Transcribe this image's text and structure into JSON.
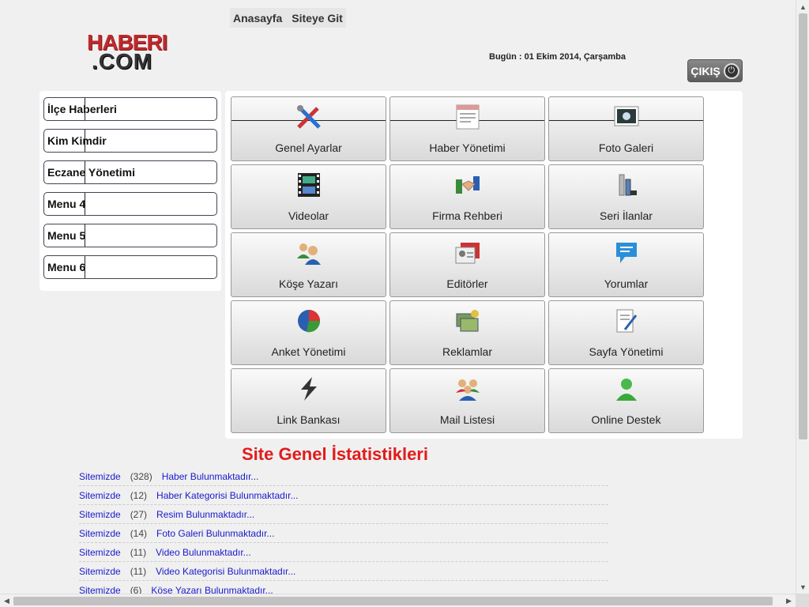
{
  "topnav": {
    "home": "Anasayfa",
    "site": "Siteye Git"
  },
  "logo": {
    "line1": "HABERI",
    "line2": ".COM"
  },
  "date": "Bugün : 01 Ekim 2014, Çarşamba",
  "logout": "ÇIKIŞ",
  "leftmenu": [
    "İlçe Haberleri",
    "Kim Kimdir",
    "Eczane Yönetimi",
    "Menu 4",
    "Menu 5",
    "Menu 6"
  ],
  "tiles": [
    {
      "label": "Genel Ayarlar",
      "icon": "tools-icon"
    },
    {
      "label": "Haber Yönetimi",
      "icon": "news-icon"
    },
    {
      "label": "Foto Galeri",
      "icon": "photo-icon"
    },
    {
      "label": "Videolar",
      "icon": "film-icon"
    },
    {
      "label": "Firma Rehberi",
      "icon": "handshake-icon"
    },
    {
      "label": "Seri İlanlar",
      "icon": "bottles-icon"
    },
    {
      "label": "Köşe Yazarı",
      "icon": "users-icon"
    },
    {
      "label": "Editörler",
      "icon": "id-card-icon"
    },
    {
      "label": "Yorumlar",
      "icon": "comment-icon"
    },
    {
      "label": "Anket Yönetimi",
      "icon": "pie-chart-icon"
    },
    {
      "label": "Reklamlar",
      "icon": "cash-icon"
    },
    {
      "label": "Sayfa Yönetimi",
      "icon": "document-edit-icon"
    },
    {
      "label": "Link Bankası",
      "icon": "lightning-icon"
    },
    {
      "label": "Mail Listesi",
      "icon": "group-icon"
    },
    {
      "label": "Online Destek",
      "icon": "support-icon"
    }
  ],
  "stats": {
    "title": "Site Genel İstatistikleri",
    "rows": [
      {
        "prefix": "Sitemizde",
        "count": "(328)",
        "text": "Haber Bulunmaktadır..."
      },
      {
        "prefix": "Sitemizde",
        "count": "(12)",
        "text": "Haber Kategorisi Bulunmaktadır..."
      },
      {
        "prefix": "Sitemizde",
        "count": "(27)",
        "text": "Resim Bulunmaktadır..."
      },
      {
        "prefix": "Sitemizde",
        "count": "(14)",
        "text": "Foto Galeri Bulunmaktadır..."
      },
      {
        "prefix": "Sitemizde",
        "count": "(11)",
        "text": "Video Bulunmaktadır..."
      },
      {
        "prefix": "Sitemizde",
        "count": "(11)",
        "text": "Video Kategorisi Bulunmaktadır..."
      },
      {
        "prefix": "Sitemizde",
        "count": "(6)",
        "text": "Köşe Yazarı Bulunmaktadır..."
      }
    ]
  }
}
